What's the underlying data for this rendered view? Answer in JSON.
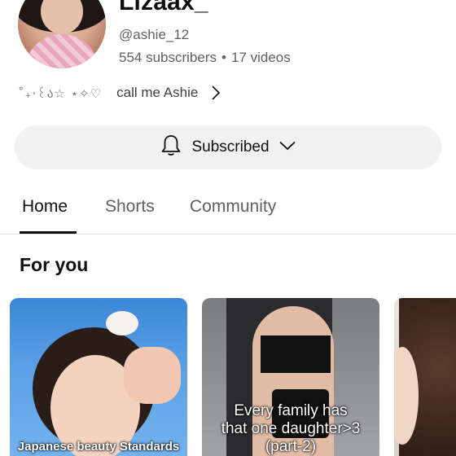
{
  "channel": {
    "name": "Lizaax_",
    "handle": "@ashie_12",
    "subscribers": "554 subscribers",
    "separator": "•",
    "videos": "17 videos",
    "bio_decor": "˚₊‧꒰ა☆ ⋆✧♡",
    "bio": "call me Ashie"
  },
  "subscribe": {
    "label": "Subscribed",
    "icons": [
      "bell-icon",
      "chevron-down-icon"
    ]
  },
  "tabs": [
    {
      "label": "Home",
      "active": true
    },
    {
      "label": "Shorts",
      "active": false
    },
    {
      "label": "Community",
      "active": false
    }
  ],
  "section": {
    "title": "For you"
  },
  "cards": [
    {
      "caption": "Japanese beauty Standards"
    },
    {
      "caption_lines": [
        "Every family has",
        "that one daughter>3",
        "(part-2)"
      ]
    },
    {
      "caption": ""
    }
  ],
  "colors": {
    "text_primary": "#0f0f0f",
    "text_secondary": "#606060",
    "button_bg": "#f1f1f1"
  }
}
